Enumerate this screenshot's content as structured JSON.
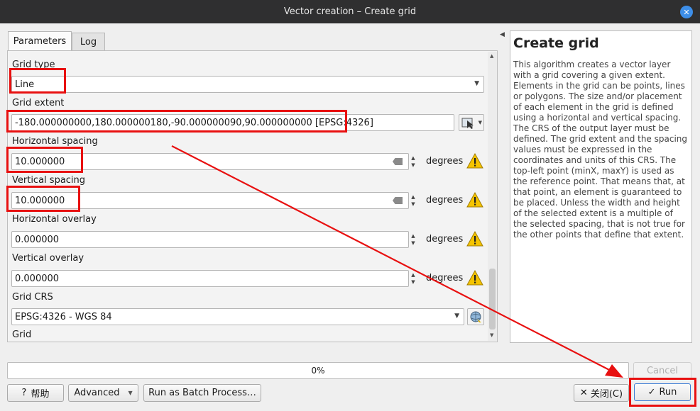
{
  "window": {
    "title": "Vector creation – Create grid",
    "close_icon": "close-icon"
  },
  "tabs": [
    {
      "label": "Parameters",
      "active": true
    },
    {
      "label": "Log",
      "active": false
    }
  ],
  "params": {
    "grid_type": {
      "label": "Grid type",
      "value": "Line"
    },
    "grid_extent": {
      "label": "Grid extent",
      "value": "-180.000000000,180.000000180,-90.000000090,90.000000000 [EPSG:4326]"
    },
    "horizontal_spacing": {
      "label": "Horizontal spacing",
      "value": "10.000000",
      "unit": "degrees"
    },
    "vertical_spacing": {
      "label": "Vertical spacing",
      "value": "10.000000",
      "unit": "degrees"
    },
    "horizontal_overlay": {
      "label": "Horizontal overlay",
      "value": "0.000000",
      "unit": "degrees"
    },
    "vertical_overlay": {
      "label": "Vertical overlay",
      "value": "0.000000",
      "unit": "degrees"
    },
    "grid_crs": {
      "label": "Grid CRS",
      "value": "EPSG:4326 - WGS 84"
    },
    "grid_output": {
      "label": "Grid"
    }
  },
  "help": {
    "title": "Create grid",
    "body": "This algorithm creates a vector layer with a grid covering a given extent. Elements in the grid can be points, lines or polygons. The size and/or placement of each element in the grid is defined using a horizontal and vertical spacing. The CRS of the output layer must be defined. The grid extent and the spacing values must be expressed in the coordinates and units of this CRS. The top-left point (minX, maxY) is used as the reference point. That means that, at that point, an element is guaranteed to be placed. Unless the width and height of the selected extent is a multiple of the selected spacing, that is not true for the other points that define that extent."
  },
  "progress": {
    "value": 0,
    "label": "0%"
  },
  "buttons": {
    "cancel": "Cancel",
    "help": "帮助",
    "advanced": "Advanced",
    "batch": "Run as Batch Process…",
    "close": "关闭(C)",
    "run": "Run"
  },
  "colors": {
    "annotation_red": "#e81010",
    "warning_yellow": "#f5c400"
  }
}
